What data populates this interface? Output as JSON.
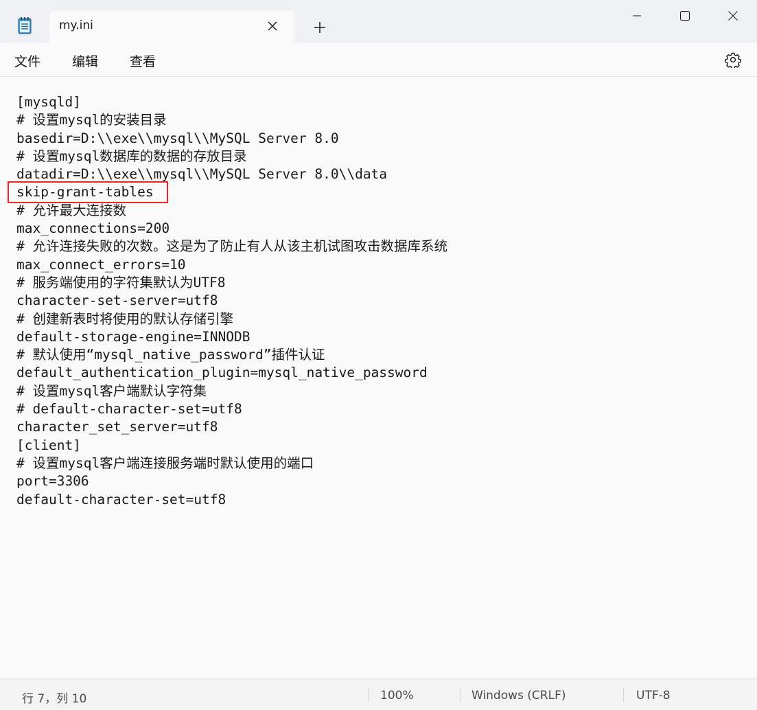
{
  "window": {
    "tab_title": "my.ini",
    "new_tab_label": "+"
  },
  "menu": {
    "file": "文件",
    "edit": "编辑",
    "view": "查看"
  },
  "editor": {
    "lines": [
      "[mysqld]",
      "# 设置mysql的安装目录",
      "basedir=D:\\\\exe\\\\mysql\\\\MySQL Server 8.0",
      "# 设置mysql数据库的数据的存放目录",
      "datadir=D:\\\\exe\\\\mysql\\\\MySQL Server 8.0\\\\data",
      "skip-grant-tables",
      "# 允许最大连接数",
      "max_connections=200",
      "# 允许连接失败的次数。这是为了防止有人从该主机试图攻击数据库系统",
      "max_connect_errors=10",
      "# 服务端使用的字符集默认为UTF8",
      "character-set-server=utf8",
      "# 创建新表时将使用的默认存储引擎",
      "default-storage-engine=INNODB",
      "# 默认使用“mysql_native_password”插件认证",
      "default_authentication_plugin=mysql_native_password",
      "# 设置mysql客户端默认字符集",
      "# default-character-set=utf8",
      "character_set_server=utf8",
      "[client]",
      "# 设置mysql客户端连接服务端时默认使用的端口",
      "port=3306",
      "default-character-set=utf8"
    ],
    "highlight_color": "#e8262b"
  },
  "status": {
    "position": "行 7，列 10",
    "zoom": "100%",
    "line_ending": "Windows (CRLF)",
    "encoding": "UTF-8"
  },
  "icons": {
    "app": "notepad-icon",
    "close_tab": "close-icon",
    "minimize": "minimize-icon",
    "maximize": "maximize-icon",
    "close_window": "close-icon",
    "settings": "gear-icon"
  }
}
